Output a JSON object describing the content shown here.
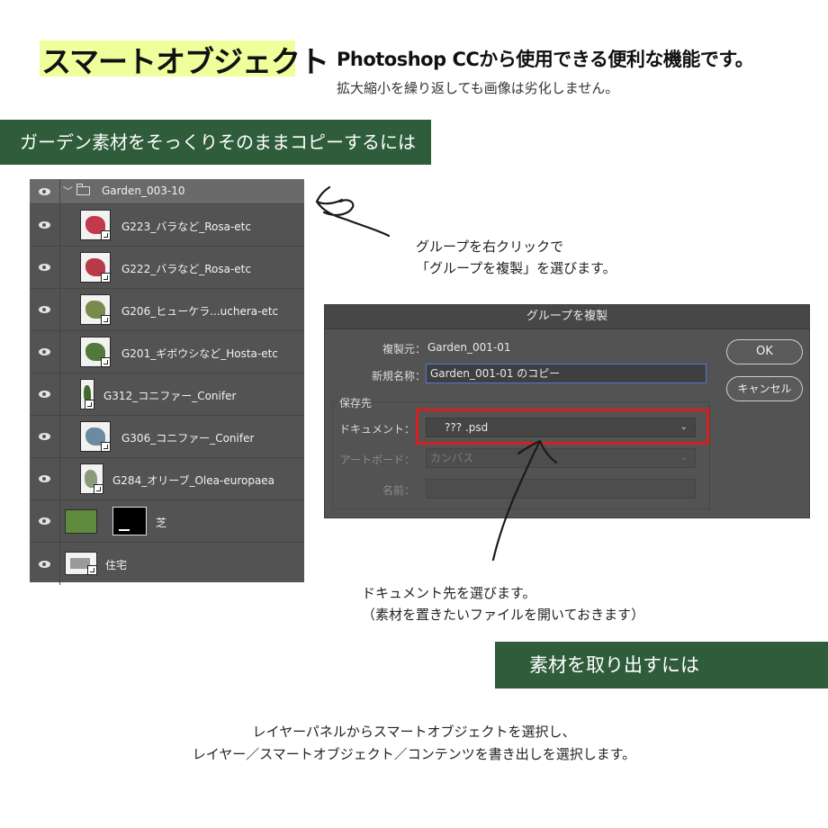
{
  "header": {
    "title": "スマートオブジェクト",
    "headline": "Photoshop CCから使用できる便利な機能です。",
    "subline": "拡大縮小を繰り返しても画像は劣化しません。"
  },
  "banners": {
    "copy": "ガーデン素材をそっくりそのままコピーするには",
    "extract": "素材を取り出すには"
  },
  "layers_panel": {
    "group": "Garden_003-10",
    "layers": [
      {
        "name": "G223_バラなど_Rosa-etc",
        "color": "#c2394a"
      },
      {
        "name": "G222_バラなど_Rosa-etc",
        "color": "#b83a48"
      },
      {
        "name": "G206_ヒューケラ...uchera-etc",
        "color": "#7a8a4a"
      },
      {
        "name": "G201_ギボウシなど_Hosta-etc",
        "color": "#4f7a3a"
      },
      {
        "name": "G312_コニファー_Conifer",
        "color": "#3f6b2e"
      },
      {
        "name": "G306_コニファー_Conifer",
        "color": "#6d8ba0"
      },
      {
        "name": "G284_オリーブ_Olea-europaea",
        "color": "#8a9b7a"
      }
    ],
    "lawn": "芝",
    "house": "住宅"
  },
  "notes": {
    "right_click_1": "グループを右クリックで",
    "right_click_2": "「グループを複製」を選びます。",
    "doc_1": "ドキュメント先を選びます。",
    "doc_2": "（素材を置きたいファイルを開いておきます）",
    "export_1": "レイヤーパネルからスマートオブジェクトを選択し、",
    "export_2": "レイヤー／スマートオブジェクト／コンテンツを書き出しを選択します。"
  },
  "dialog": {
    "title": "グループを複製",
    "source_label": "複製元：",
    "source_value": "Garden_001-01",
    "name_label": "新規名称：",
    "name_value": "Garden_001-01 のコピー",
    "section": "保存先",
    "document_label": "ドキュメント：",
    "document_value": "???     .psd",
    "artboard_label": "アートボード：",
    "artboard_value": "カンバス",
    "filename_label": "名前：",
    "ok": "OK",
    "cancel": "キャンセル"
  }
}
